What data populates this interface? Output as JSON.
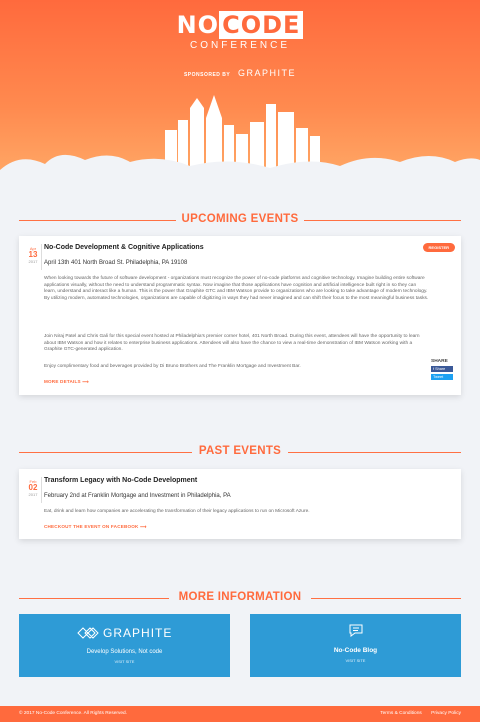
{
  "header": {
    "logo_no": "NO",
    "logo_code": "CODE",
    "logo_sub": "CONFERENCE",
    "sponsored_by": "SPONSORED BY",
    "sponsor_name": "GRAPHITE"
  },
  "upcoming": {
    "title": "UPCOMING EVENTS",
    "event": {
      "month": "Apr",
      "day": "13",
      "year": "2017",
      "title": "No-Code Development & Cognitive Applications",
      "register": "REGISTER",
      "subtitle": "April 13th 401 North Broad St. Philadelphia, PA 19108",
      "p1": "When looking towards the future of software development - organizations must recognize the power of no-code platforms and cognitive technology. Imagine building entire software applications visually, without the need to understand programmatic syntax. Now imagine that those applications have cognition and artificial intelligence built right in so they can learn, understand and interact like a human. This is the power that Graphite GTC and IBM Watson provide to organizations who are looking to take advantage of modern technology. By utilizing modern, automated technologies, organizations are capable of digitizing in ways they had never imagined and can shift their focus to the most meaningful business tasks.",
      "p2": "Join Niraj Patel and Chris Gali for this special event hosted at Philadelphia's premier corner hotel, 401 North Broad. During this event, attendees will have the opportunity to learn about IBM Watson and how it relates to enterprise business applications. Attendees will also have the chance to view a real-time demonstration of IBM Watson working with a Graphite GTC-generated application.",
      "p3": "Enjoy complimentary food and beverages provided by Di Bruno Brothers and The Franklin Mortgage and Investment Bar.",
      "more": "MORE DETAILS ⟶",
      "share_label": "SHARE",
      "share_fb": "f Share",
      "share_tw": "Tweet"
    }
  },
  "past": {
    "title": "PAST EVENTS",
    "event": {
      "month": "Feb",
      "day": "02",
      "year": "2017",
      "title": "Transform Legacy with No-Code Development",
      "subtitle": "February 2nd at Franklin Mortgage and Investment in Philadelphia, PA",
      "p1": "Eat, drink and learn how companies are accelerating the transformation of their legacy applications to run on Microsoft Azure.",
      "link": "CHECKOUT THE EVENT ON FACEBOOK ⟶"
    }
  },
  "more_info": {
    "title": "MORE INFORMATION",
    "graphite": {
      "brand": "GRAPHITE",
      "tagline": "Develop Solutions, Not code",
      "link": "VISIT SITE"
    },
    "blog": {
      "title": "No-Code Blog",
      "link": "VISIT SITE"
    }
  },
  "footer": {
    "copyright": "© 2017 No-Code Conference. All Rights Reserved.",
    "terms": "Terms & Conditions",
    "privacy": "Privacy Policy"
  },
  "colors": {
    "accent": "#ff6a3d",
    "blue": "#2e9bd6",
    "background": "#f1f3f7"
  }
}
